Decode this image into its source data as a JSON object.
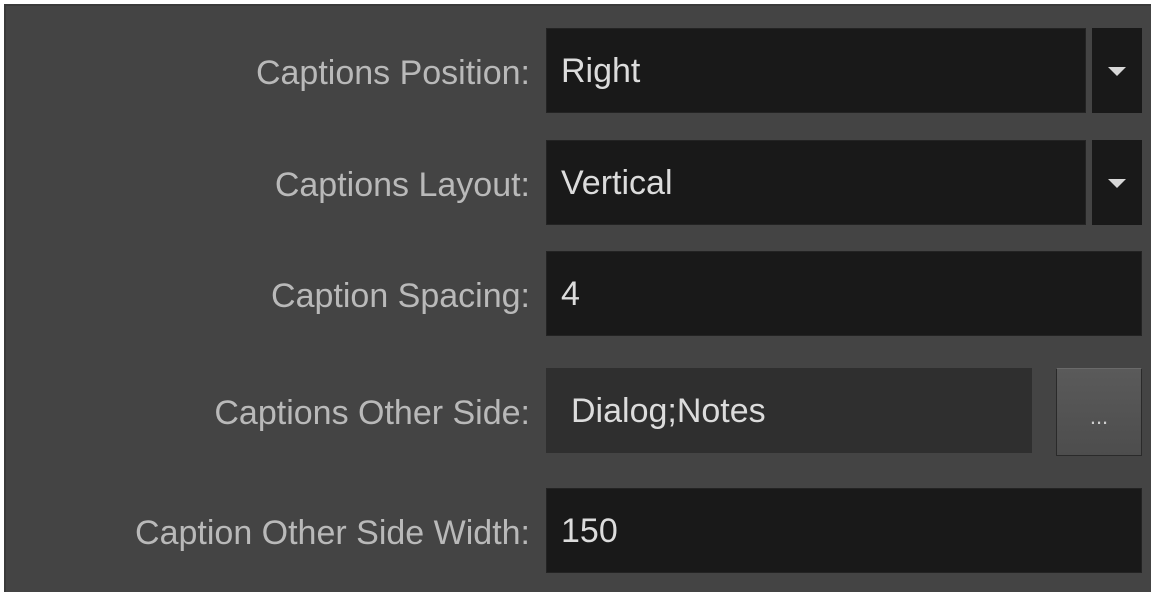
{
  "properties": [
    {
      "label": "Captions Position:",
      "type": "combo",
      "value": "Right",
      "icon": "chevron-down-icon"
    },
    {
      "label": "Captions Layout:",
      "type": "combo",
      "value": "Vertical",
      "icon": "chevron-down-icon"
    },
    {
      "label": "Caption Spacing:",
      "type": "text",
      "value": "4"
    },
    {
      "label": "Captions Other Side:",
      "type": "browse",
      "value": "Dialog;Notes",
      "button_label": "..."
    },
    {
      "label": "Caption Other Side Width:",
      "type": "text",
      "value": "150"
    }
  ],
  "colors": {
    "panel_background": "#444444",
    "field_background": "#191919",
    "readonly_field_background": "#2f2f2f",
    "label_text": "#b9b9b9",
    "value_text": "#dcdcdc"
  }
}
